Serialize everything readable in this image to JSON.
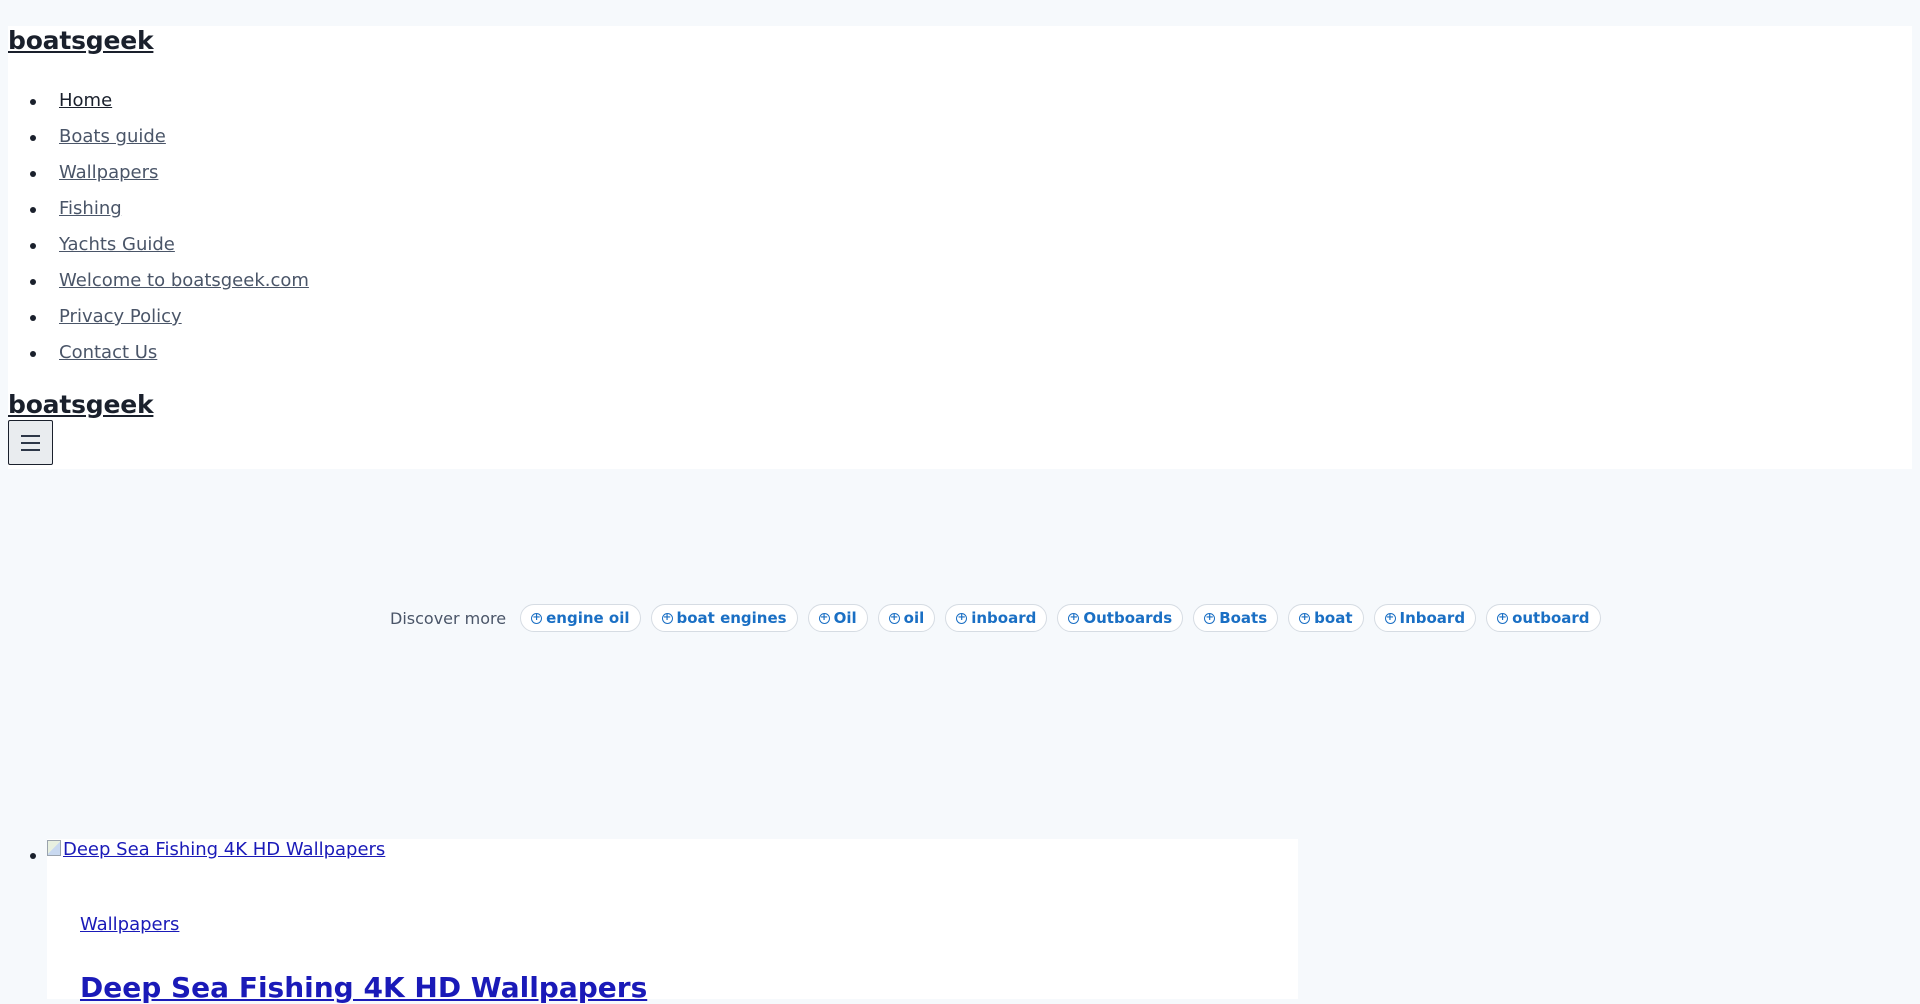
{
  "header": {
    "site_title": "boatsgeek",
    "nav": [
      {
        "label": "Home"
      },
      {
        "label": "Boats guide"
      },
      {
        "label": "Wallpapers"
      },
      {
        "label": "Fishing"
      },
      {
        "label": "Yachts Guide"
      },
      {
        "label": "Welcome to boatsgeek.com"
      },
      {
        "label": "Privacy Policy"
      },
      {
        "label": "Contact Us"
      }
    ],
    "site_title_mobile": "boatsgeek",
    "menu_icon": "hamburger-icon"
  },
  "discover": {
    "label": "Discover more",
    "chip_icon": "plus-circle-icon",
    "chips": [
      "engine oil",
      "boat engines",
      "Oil",
      "oil",
      "inboard",
      "Outboards",
      "Boats",
      "boat",
      "Inboard",
      "outboard"
    ]
  },
  "post": {
    "image_alt": "Deep Sea Fishing 4K HD Wallpapers",
    "category": "Wallpapers",
    "title": "Deep Sea Fishing 4K HD Wallpapers"
  },
  "colors": {
    "page_background": "#f6f9fc",
    "header_background": "#ffffff",
    "chip_text": "#1a6fc4",
    "link_blue": "#1a1ab8"
  }
}
